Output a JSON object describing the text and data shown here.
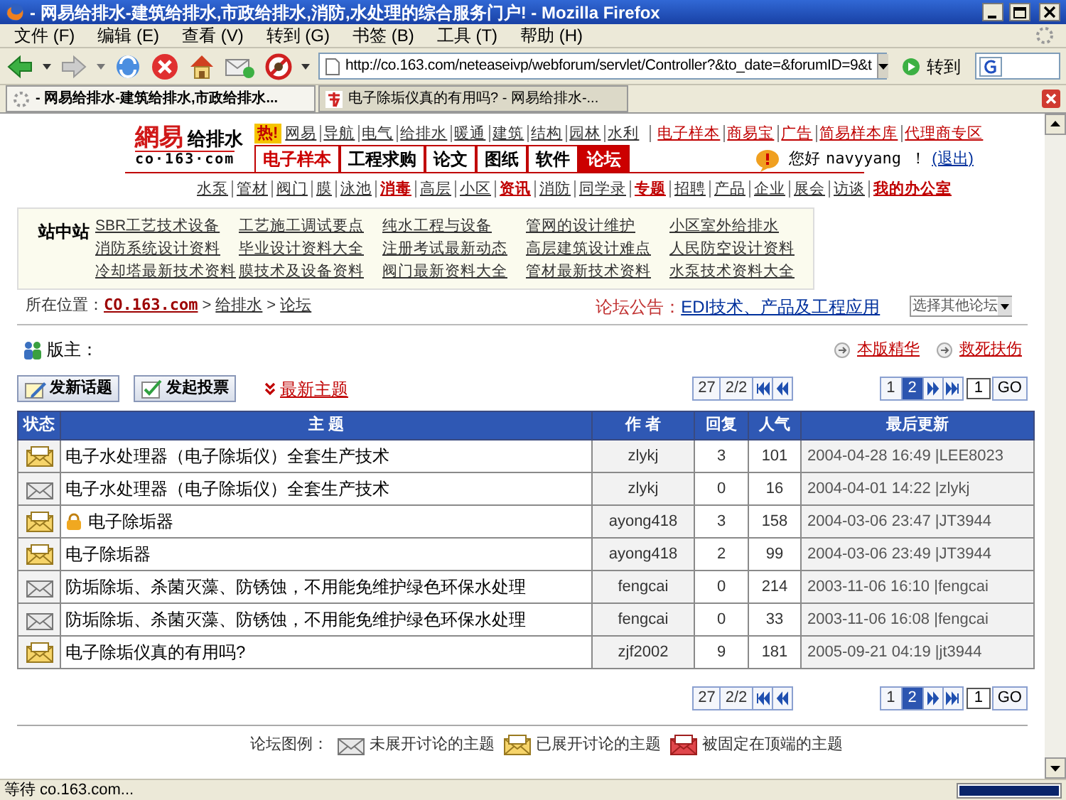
{
  "browser": {
    "title": "- 网易给排水-建筑给排水,市政给排水,消防,水处理的综合服务门户! - Mozilla Firefox",
    "menu": [
      "文件 (F)",
      "编辑 (E)",
      "查看 (V)",
      "转到 (G)",
      "书签 (B)",
      "工具 (T)",
      "帮助 (H)"
    ],
    "address": "http://co.163.com/neteaseivp/webforum/servlet/Controller?&to_date=&forumID=9&t",
    "go_label": "转到",
    "tabs": [
      {
        "label": "- 网易给排水-建筑给排水,市政给排水...",
        "selected": true,
        "kind": "loading"
      },
      {
        "label": "电子除垢仪真的有用吗? - 网易给排水-...",
        "selected": false,
        "kind": "site"
      }
    ],
    "status_text": "等待 co.163.com...",
    "progress": {
      "level": 1
    }
  },
  "site": {
    "logo_brand": "網易",
    "logo_name": "给排水",
    "logo_domain": "co·163·com",
    "hot_badge": "热!",
    "top_links": [
      {
        "label": "网易",
        "kind": "plain"
      },
      {
        "label": "导航",
        "kind": "plain"
      },
      {
        "label": "电气",
        "kind": "plain"
      },
      {
        "label": "给排水",
        "kind": "plain"
      },
      {
        "label": "暖通",
        "kind": "plain"
      },
      {
        "label": "建筑",
        "kind": "plain"
      },
      {
        "label": "结构",
        "kind": "plain"
      },
      {
        "label": "园林",
        "kind": "plain"
      },
      {
        "label": "水利",
        "kind": "plain"
      },
      {
        "label": "电子样本",
        "kind": "red"
      },
      {
        "label": "商易宝",
        "kind": "red"
      },
      {
        "label": "广告",
        "kind": "red"
      },
      {
        "label": "简易样本库",
        "kind": "red"
      },
      {
        "label": "代理商专区",
        "kind": "red"
      }
    ],
    "main_tabs": [
      {
        "label": "电子样本",
        "selected": false
      },
      {
        "label": "工程求购",
        "selected": false
      },
      {
        "label": "论文",
        "selected": false
      },
      {
        "label": "图纸",
        "selected": false
      },
      {
        "label": "软件",
        "selected": false
      },
      {
        "label": "论坛",
        "selected": true
      }
    ],
    "greeting": "您好",
    "user": "navyyang ！",
    "logout": "(退出)",
    "sub_links": [
      {
        "label": "水泵",
        "highlighted": false
      },
      {
        "label": "管材",
        "highlighted": false
      },
      {
        "label": "阀门",
        "highlighted": false
      },
      {
        "label": "膜",
        "highlighted": false
      },
      {
        "label": "泳池",
        "highlighted": false
      },
      {
        "label": "消毒",
        "highlighted": true
      },
      {
        "label": "高层",
        "highlighted": false
      },
      {
        "label": "小区",
        "highlighted": false
      },
      {
        "label": "资讯",
        "highlighted": true
      },
      {
        "label": "消防",
        "highlighted": false
      },
      {
        "label": "同学录",
        "highlighted": false
      },
      {
        "label": "专题",
        "highlighted": true
      },
      {
        "label": "招聘",
        "highlighted": false
      },
      {
        "label": "产品",
        "highlighted": false
      },
      {
        "label": "企业",
        "highlighted": false
      },
      {
        "label": "展会",
        "highlighted": false
      },
      {
        "label": "访谈",
        "highlighted": false
      },
      {
        "label": "我的办公室",
        "highlighted": true
      }
    ]
  },
  "station": {
    "title": "站中站",
    "links": [
      "SBR工艺技术设备",
      "工艺施工调试要点",
      "纯水工程与设备",
      "管网的设计维护",
      "小区室外给排水",
      "消防系统设计资料",
      "毕业设计资料大全",
      "注册考试最新动态",
      "高层建筑设计难点",
      "人民防空设计资料",
      "冷却塔最新技术资料",
      "膜技术及设备资料",
      "阀门最新资料大全",
      "管材最新技术资料",
      "水泵技术资料大全"
    ]
  },
  "location": {
    "label": "所在位置：",
    "crumbs": [
      "CO.163.com",
      "给排水",
      "论坛"
    ],
    "separator": ">",
    "notice_label": "论坛公告：",
    "notice": "EDI技术、产品及工程应用",
    "forum_select": "选择其他论坛"
  },
  "moderator_label": "版主：",
  "side_links": [
    "本版精华",
    "救死扶伤"
  ],
  "actions": [
    "发新话题",
    "发起投票"
  ],
  "latest": "最新主题",
  "pagers": [
    {
      "count": "27",
      "pages": "2/2",
      "numbers": [
        {
          "label": "1",
          "selected": false
        },
        {
          "label": "2",
          "selected": true
        }
      ],
      "input": "1",
      "go": "GO"
    },
    {
      "count": "27",
      "pages": "2/2",
      "numbers": [
        {
          "label": "1",
          "selected": false
        },
        {
          "label": "2",
          "selected": true
        }
      ],
      "input": "1",
      "go": "GO"
    }
  ],
  "table": {
    "columns": [
      "状态",
      "主 题",
      "作 者",
      "回复",
      "人气",
      "最后更新"
    ],
    "rows": [
      {
        "kind": "open",
        "locked": false,
        "title": "电子水处理器（电子除垢仪）全套生产技术",
        "author": "zlykj",
        "replies": "3",
        "views": "101",
        "last": "2004-04-28 16:49 |LEE8023"
      },
      {
        "kind": "closed",
        "locked": false,
        "title": "电子水处理器（电子除垢仪）全套生产技术",
        "author": "zlykj",
        "replies": "0",
        "views": "16",
        "last": "2004-04-01 14:22 |zlykj"
      },
      {
        "kind": "open",
        "locked": true,
        "title": "电子除垢器",
        "author": "ayong418",
        "replies": "3",
        "views": "158",
        "last": "2004-03-06 23:47 |JT3944"
      },
      {
        "kind": "open",
        "locked": false,
        "title": "电子除垢器",
        "author": "ayong418",
        "replies": "2",
        "views": "99",
        "last": "2004-03-06 23:49 |JT3944"
      },
      {
        "kind": "closed",
        "locked": false,
        "title": "防垢除垢、杀菌灭藻、防锈蚀，不用能免维护绿色环保水处理",
        "author": "fengcai",
        "replies": "0",
        "views": "214",
        "last": "2003-11-06 16:10 |fengcai"
      },
      {
        "kind": "closed",
        "locked": false,
        "title": "防垢除垢、杀菌灭藻、防锈蚀，不用能免维护绿色环保水处理",
        "author": "fengcai",
        "replies": "0",
        "views": "33",
        "last": "2003-11-06 16:08 |fengcai"
      },
      {
        "kind": "open",
        "locked": false,
        "title": "电子除垢仪真的有用吗?",
        "author": "zjf2002",
        "replies": "9",
        "views": "181",
        "last": "2005-09-21 04:19 |jt3944"
      }
    ]
  },
  "legend": {
    "label": "论坛图例：",
    "items": [
      {
        "kind": "closed",
        "label": "未展开讨论的主题"
      },
      {
        "kind": "open",
        "label": "已展开讨论的主题"
      },
      {
        "kind": "pinned",
        "label": "被固定在顶端的主题"
      }
    ]
  }
}
